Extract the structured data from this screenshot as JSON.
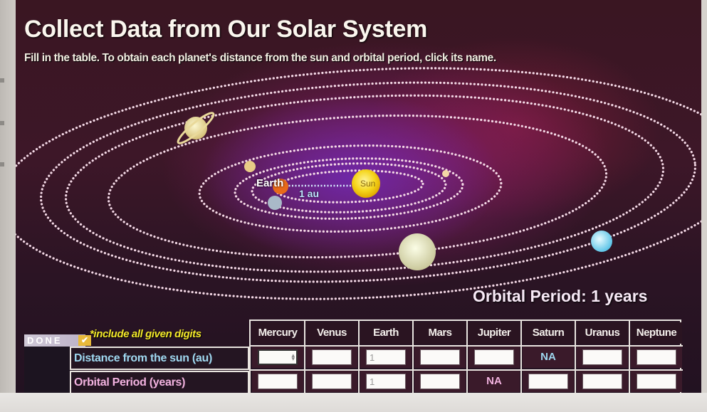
{
  "title": "Collect Data from Our Solar System",
  "instructions": "Fill in the table. To obtain each planet's distance from the sun and orbital period, click its name.",
  "diagram": {
    "earth_label": "Earth",
    "distance_label": "1 au",
    "sun_label": "Sun",
    "orbital_period_readout": "Orbital Period: 1 years",
    "planets": [
      "mercury",
      "venus",
      "earth",
      "mars",
      "jupiter",
      "saturn",
      "uranus",
      "neptune"
    ]
  },
  "controls": {
    "done_label": "DONE",
    "done_icon": "check-icon",
    "note": "*include all given digits"
  },
  "table": {
    "row_labels": [
      "Distance from the sun (au)",
      "Orbital Period (years)"
    ],
    "columns": [
      {
        "name": "Mercury",
        "distance": "",
        "period": ""
      },
      {
        "name": "Venus",
        "distance": "",
        "period": ""
      },
      {
        "name": "Earth",
        "distance": "1",
        "period": "1"
      },
      {
        "name": "Mars",
        "distance": "",
        "period": ""
      },
      {
        "name": "Jupiter",
        "distance": "",
        "period": "NA"
      },
      {
        "name": "Saturn",
        "distance": "NA",
        "period": ""
      },
      {
        "name": "Uranus",
        "distance": "",
        "period": ""
      },
      {
        "name": "Neptune",
        "distance": "",
        "period": ""
      }
    ]
  },
  "colors": {
    "title": "#fbf6ee",
    "note": "#f3e82a",
    "distance_row": "#9fd8f0",
    "period_row": "#f3b3e0",
    "sun": "#f5d51c"
  }
}
